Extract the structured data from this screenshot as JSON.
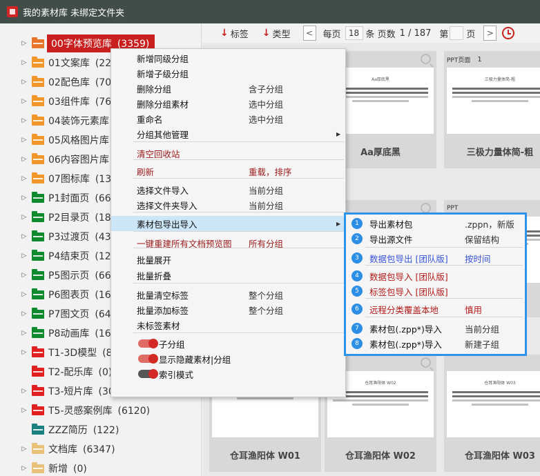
{
  "window": {
    "title": "我的素材库  未绑定文件夹"
  },
  "toolbar": {
    "sort_tag": "标签",
    "sort_type": "类型",
    "per_page_label": "每页",
    "per_page_value": "18",
    "per_page_unit": "条 页数",
    "page_info": "1 / 187",
    "goto_label": "第",
    "goto_value": "",
    "goto_unit": "页"
  },
  "sidebar": {
    "items": [
      {
        "label": "00字体预览库",
        "count": "(3359)",
        "color": "#e8732a",
        "selected": true
      },
      {
        "label": "01文案库",
        "count": "(22)",
        "color": "#f0962b"
      },
      {
        "label": "02配色库",
        "count": "(701",
        "color": "#f0962b"
      },
      {
        "label": "03组件库",
        "count": "(768",
        "color": "#f0962b"
      },
      {
        "label": "04装饰元素库",
        "count": "(",
        "color": "#f0962b"
      },
      {
        "label": "05风格图片库",
        "count": "(",
        "color": "#f0962b"
      },
      {
        "label": "06内容图片库",
        "count": "(",
        "color": "#f0962b"
      },
      {
        "label": "07图标库",
        "count": "(131",
        "color": "#f0962b"
      },
      {
        "label": "P1封面页",
        "count": "(663",
        "color": "#0f8a2e"
      },
      {
        "label": "P2目录页",
        "count": "(182",
        "color": "#0f8a2e"
      },
      {
        "label": "P3过渡页",
        "count": "(431",
        "color": "#0f8a2e"
      },
      {
        "label": "P4结束页",
        "count": "(129",
        "color": "#0f8a2e"
      },
      {
        "label": "P5图示页",
        "count": "(660",
        "color": "#0f8a2e"
      },
      {
        "label": "P6图表页",
        "count": "(166",
        "color": "#0f8a2e"
      },
      {
        "label": "P7图文页",
        "count": "(645",
        "color": "#0f8a2e"
      },
      {
        "label": "P8动画库",
        "count": "(164",
        "color": "#0f8a2e"
      },
      {
        "label": "T1-3D模型",
        "count": "(82",
        "color": "#e02020"
      },
      {
        "label": "T2-配乐库",
        "count": "(0)",
        "color": "#e02020",
        "no_arrow": true
      },
      {
        "label": "T3-短片库",
        "count": "(306",
        "color": "#e02020"
      },
      {
        "label": "T5-灵感案例库",
        "count": "(6120)",
        "color": "#e02020"
      },
      {
        "label": "ZZZ简历",
        "count": "(122)",
        "color": "#1b8080",
        "no_arrow": true
      },
      {
        "label": "文档库",
        "count": "(6347)",
        "color": "#e8c27a"
      },
      {
        "label": "新增",
        "count": "(0)",
        "color": "#e8c27a"
      }
    ]
  },
  "cards": [
    {
      "type": "",
      "num": "1",
      "name": "Aa厚底黑",
      "thumb_title": "Aa厚底黑"
    },
    {
      "type": "PPT页面",
      "num": "1",
      "name": "三极力量体简-粗",
      "thumb_title": "三极力量体简-粗"
    },
    {
      "type": "",
      "num": "",
      "name": "",
      "thumb_title": ""
    },
    {
      "type": "PPT",
      "num": "",
      "name": "",
      "thumb_title": ""
    },
    {
      "type": "",
      "num": "",
      "name": "仓耳渔阳体 W01",
      "thumb_title": ""
    },
    {
      "type": "",
      "num": "",
      "name": "仓耳渔阳体 W02",
      "thumb_title": "仓耳渔阳体 W02"
    },
    {
      "type": "",
      "num": "",
      "name": "仓耳渔阳体 W03",
      "thumb_title": "仓耳渔阳体 W03"
    }
  ],
  "context_menu": {
    "items": [
      {
        "label": "新增同级分组",
        "hint": ""
      },
      {
        "label": "新增子级分组",
        "hint": ""
      },
      {
        "label": "删除分组",
        "hint": "含子分组"
      },
      {
        "label": "删除分组素材",
        "hint": "选中分组"
      },
      {
        "label": "重命名",
        "hint": "选中分组"
      },
      {
        "label": "分组其他管理",
        "hint": "",
        "submenu": true
      },
      {
        "label": "清空回收站",
        "hint": "",
        "red": true
      },
      {
        "label": "刷新",
        "hint": "重载，排序",
        "red": true
      },
      {
        "label": "选择文件导入",
        "hint": "当前分组"
      },
      {
        "label": "选择文件夹导入",
        "hint": "当前分组"
      },
      {
        "label": "素材包导出导入",
        "hint": "",
        "submenu": true,
        "highlight": true
      },
      {
        "label": "一键重建所有文档预览图",
        "hint": "所有分组",
        "red": true
      },
      {
        "label": "批量展开",
        "hint": ""
      },
      {
        "label": "批量折叠",
        "hint": ""
      },
      {
        "label": "批量清空标签",
        "hint": "整个分组"
      },
      {
        "label": "批量添加标签",
        "hint": "整个分组"
      },
      {
        "label": "未标签素材",
        "hint": ""
      },
      {
        "label": "子分组",
        "hint": "",
        "toggle": "on"
      },
      {
        "label": "显示隐藏素材|分组",
        "hint": "",
        "toggle": "on"
      },
      {
        "label": "索引模式",
        "hint": "",
        "toggle": "off"
      }
    ]
  },
  "submenu": {
    "items": [
      {
        "num": "1",
        "label": "导出素材包",
        "hint": ".zppn，新版"
      },
      {
        "num": "2",
        "label": "导出源文件",
        "hint": "保留结构"
      },
      {
        "num": "3",
        "label": "数据包导出 [团队版]",
        "hint": "按时间",
        "style": "blue"
      },
      {
        "num": "4",
        "label": "数据包导入 [团队版]",
        "hint": "",
        "style": "red"
      },
      {
        "num": "5",
        "label": "标签包导入 [团队版]",
        "hint": "",
        "style": "red"
      },
      {
        "num": "6",
        "label": "远程分类覆盖本地",
        "hint": "慎用",
        "style": "red"
      },
      {
        "num": "7",
        "label": "素材包(.zpp*)导入",
        "hint": "当前分组"
      },
      {
        "num": "8",
        "label": "素材包(.zpp*)导入",
        "hint": "新建子组"
      }
    ]
  }
}
